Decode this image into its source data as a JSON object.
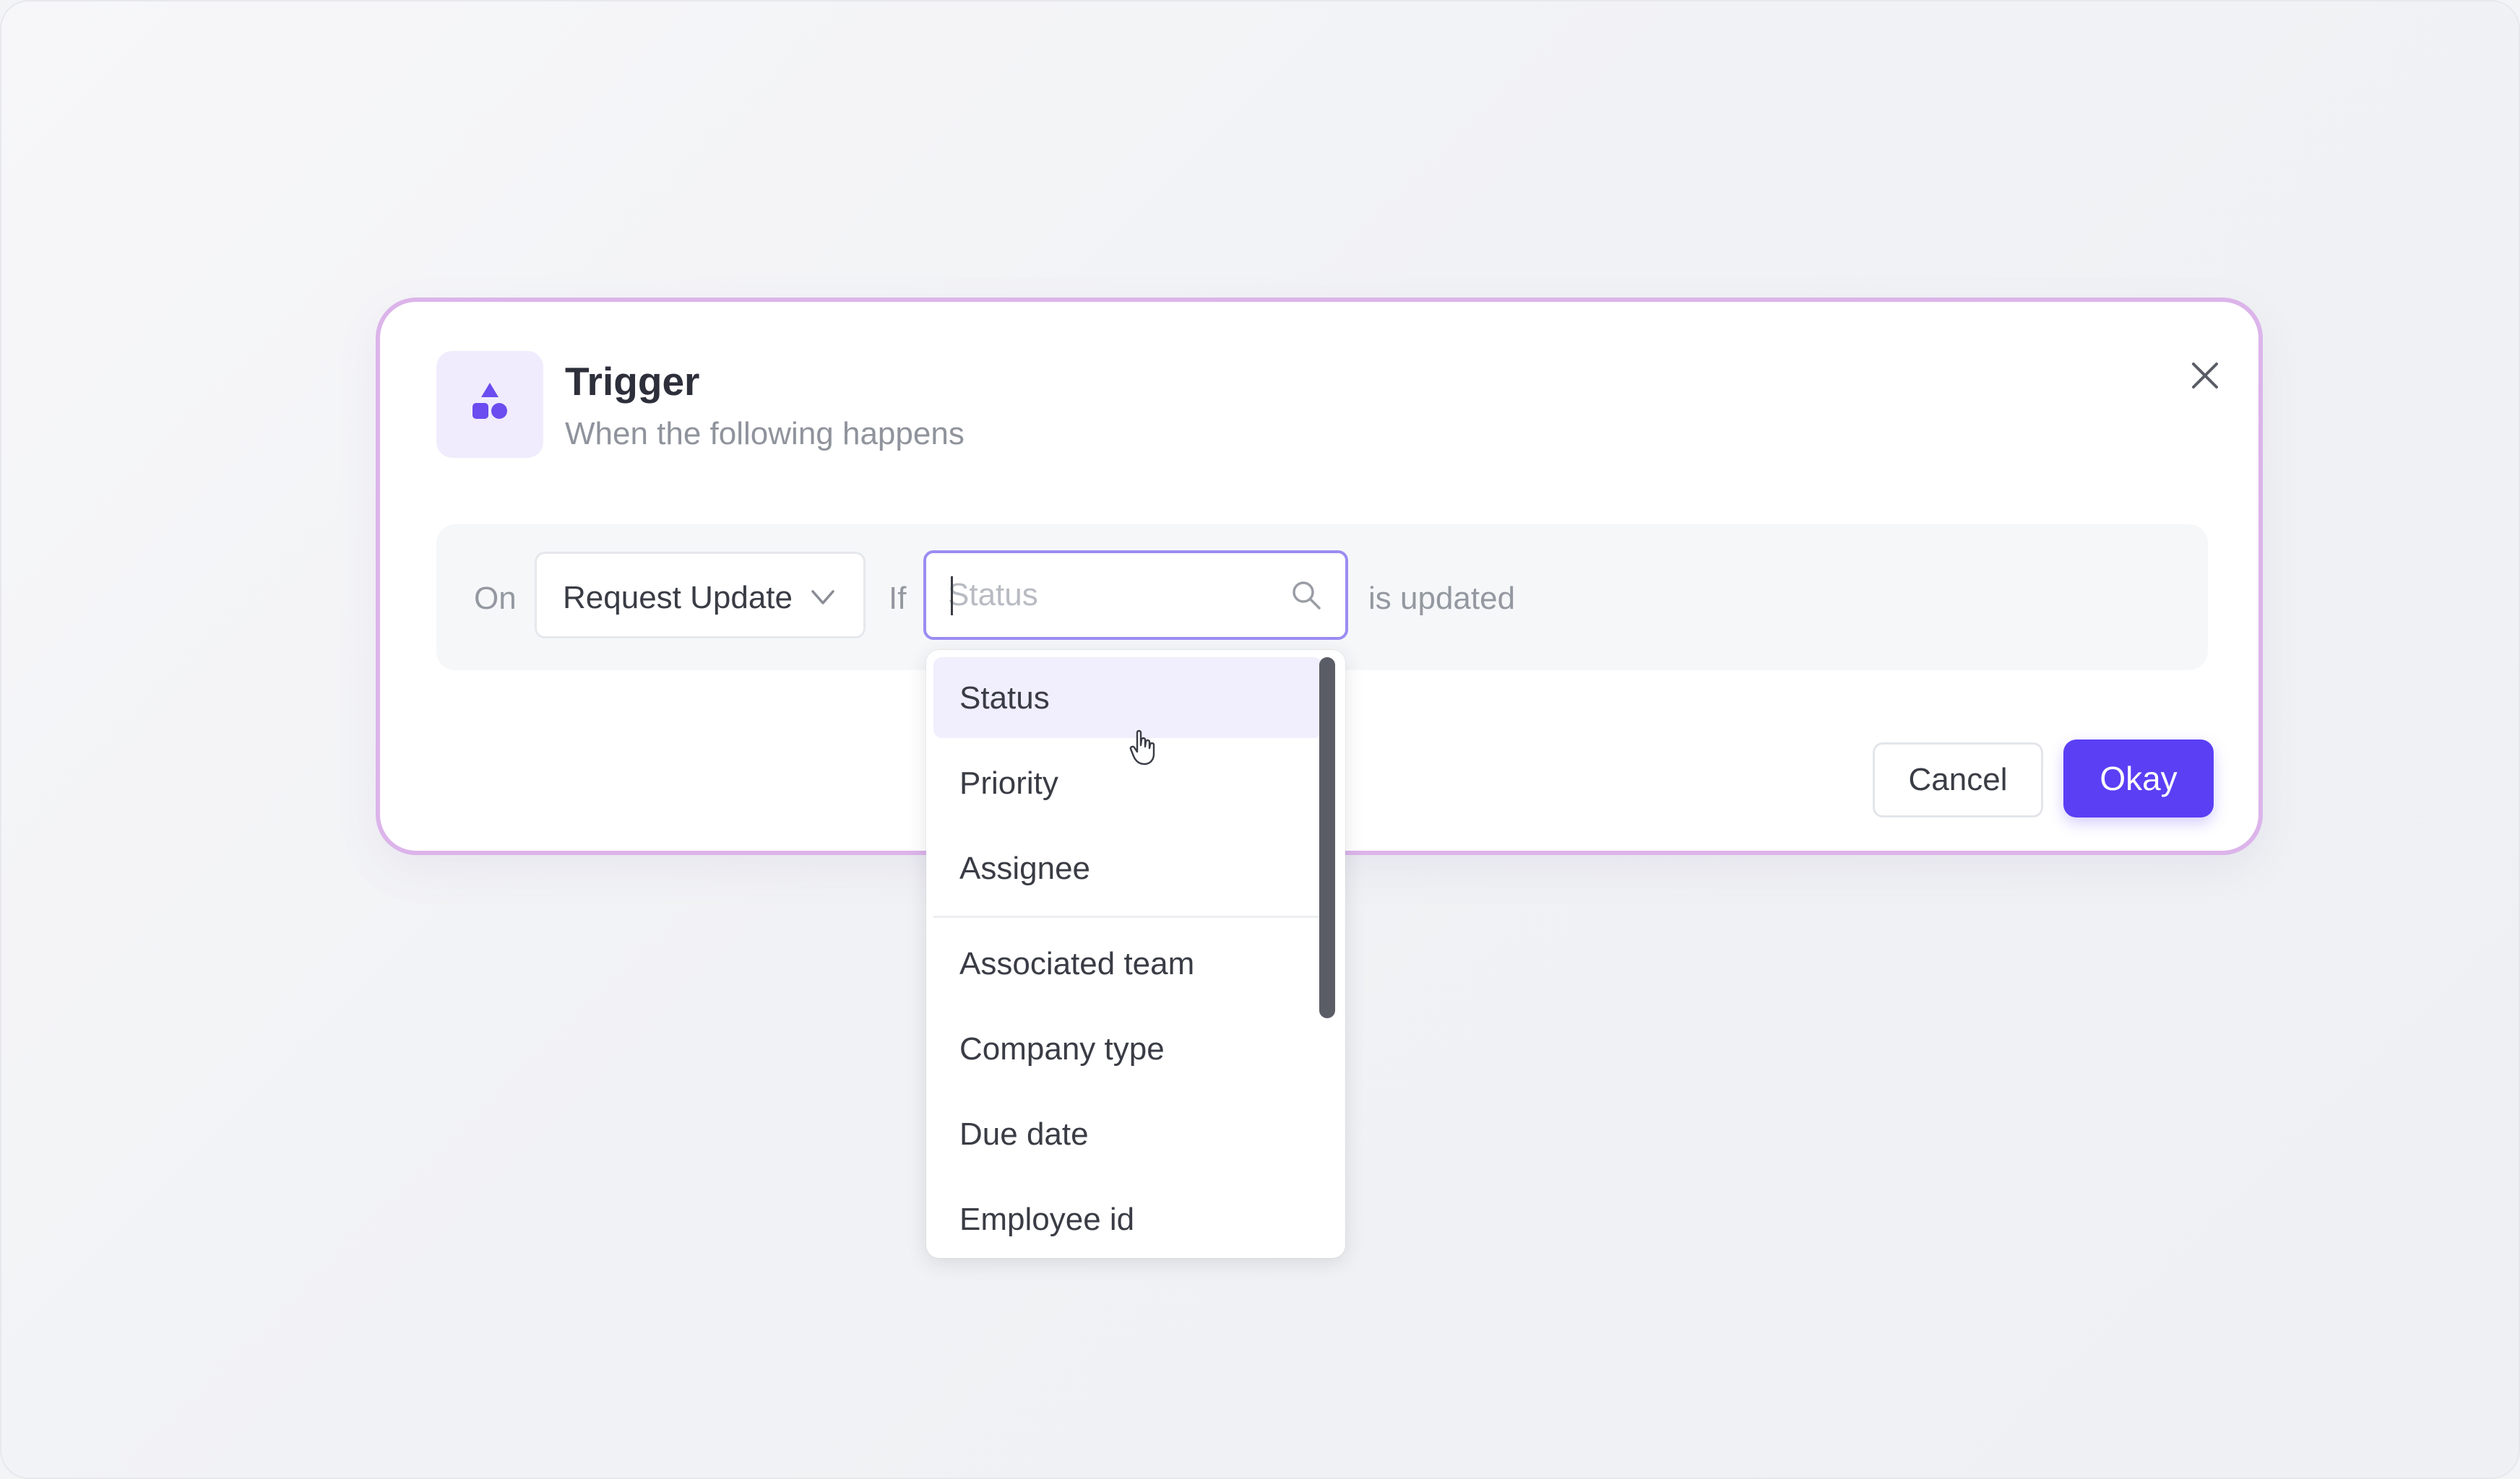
{
  "modal": {
    "icon": "shapes-icon",
    "title": "Trigger",
    "subtitle": "When the following happens",
    "close_icon": "close-icon",
    "border_color": "#dcb4ea"
  },
  "condition": {
    "on_label": "On",
    "event_select": {
      "value": "Request Update",
      "icon": "chevron-down-icon"
    },
    "if_label": "If",
    "field_search": {
      "placeholder": "Status",
      "value": "",
      "icon": "search-icon"
    },
    "suffix_label": "is updated"
  },
  "dropdown": {
    "items": [
      {
        "label": "Status",
        "selected": true
      },
      {
        "label": "Priority",
        "selected": false
      },
      {
        "label": "Assignee",
        "selected": false
      },
      {
        "label": "Associated team",
        "selected": false
      },
      {
        "label": "Company type",
        "selected": false
      },
      {
        "label": "Due date",
        "selected": false
      },
      {
        "label": "Employee id",
        "selected": false
      }
    ]
  },
  "actions": {
    "cancel_label": "Cancel",
    "okay_label": "Okay"
  },
  "colors": {
    "accent": "#5b3ff5",
    "icon_tile": "#f0ecfd",
    "selected_row": "#f1eefd"
  }
}
